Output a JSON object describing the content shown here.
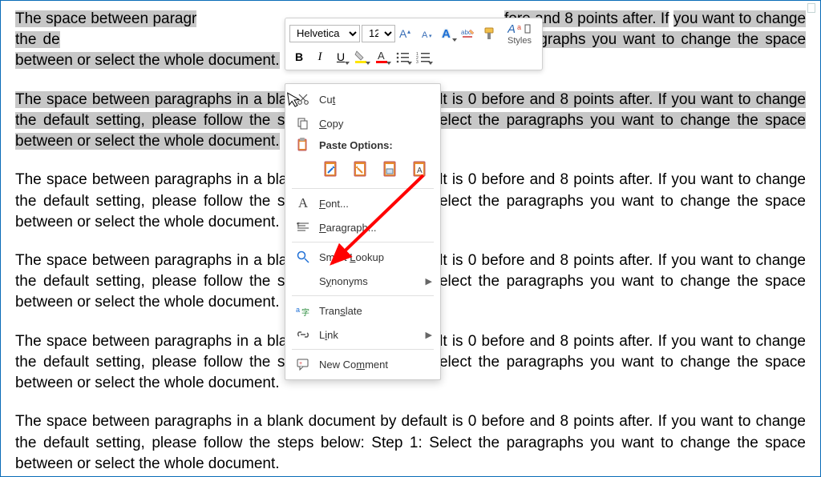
{
  "doc": {
    "paragraph_text": "The space between paragraphs in a blank document by default is 0 before and 8 points after. If you want to change the default setting, please follow the steps below: Step 1: Select the paragraphs you want to change the space between or select the whole document.",
    "para1_top": "The space between paragr",
    "para1_mid": "you want to change the de",
    "para1_bot": "paragraphs you want to change the space between or select the whole document.",
    "p1_top_right": "fore and 8 points after. If",
    "p1_mid_right": "below: Step 1: Select the"
  },
  "mini": {
    "font_name": "Helvetica",
    "font_size": "12",
    "styles_label": "Styles"
  },
  "ctx": {
    "cut": "Cut",
    "copy": "Copy",
    "paste_header": "Paste Options:",
    "font": "Font...",
    "paragraph": "Paragraph...",
    "smart": "Smart Lookup",
    "synonyms": "Synonyms",
    "translate": "Translate",
    "link": "Link",
    "new_comment": "New Comment"
  },
  "colors": {
    "highlight_yellow": "#ffe600",
    "accent_blue": "#1e6fd6",
    "red": "#ff0000",
    "orange": "#e88b2d"
  }
}
